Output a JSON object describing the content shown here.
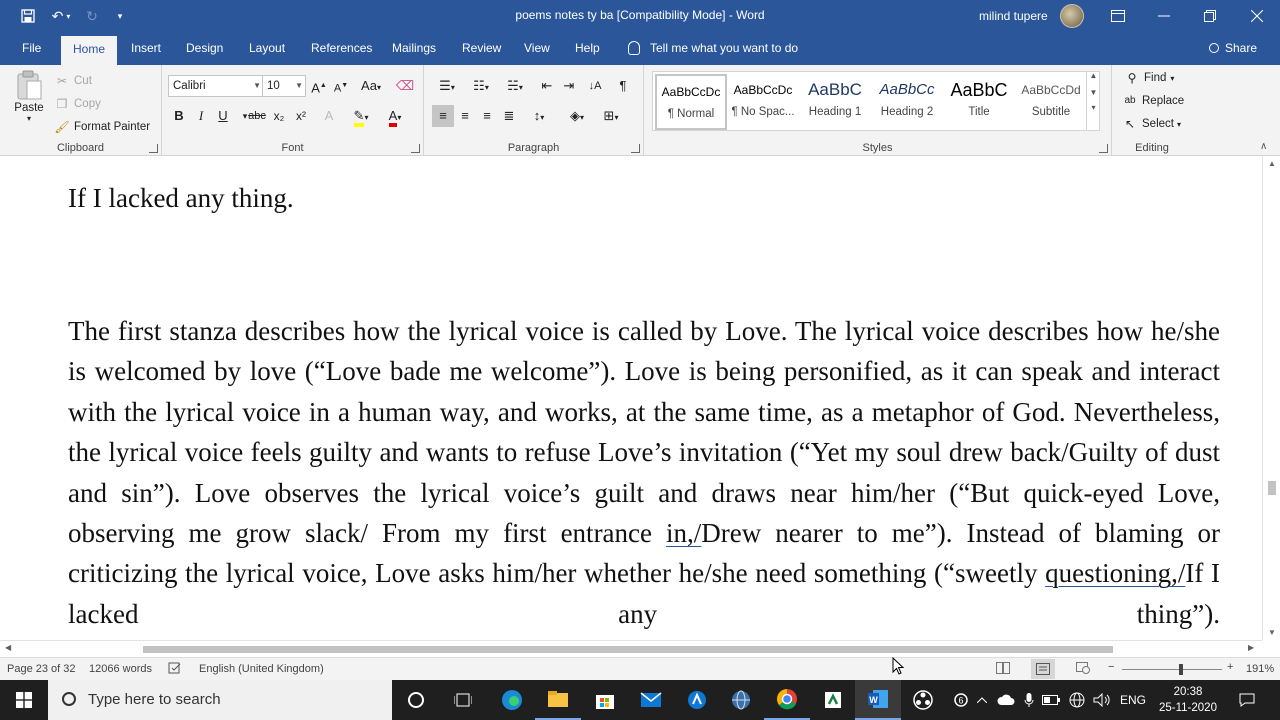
{
  "titlebar": {
    "doc_title": "poems notes ty ba [Compatibility Mode]  -  Word",
    "user_name": "milind tupere",
    "colors": {
      "brand": "#2b579a"
    }
  },
  "tabs": [
    {
      "label": "File"
    },
    {
      "label": "Home"
    },
    {
      "label": "Insert"
    },
    {
      "label": "Design"
    },
    {
      "label": "Layout"
    },
    {
      "label": "References"
    },
    {
      "label": "Mailings"
    },
    {
      "label": "Review"
    },
    {
      "label": "View"
    },
    {
      "label": "Help"
    }
  ],
  "tell_me": "Tell me what you want to do",
  "share": "Share",
  "clipboard": {
    "paste": "Paste",
    "cut": "Cut",
    "copy": "Copy",
    "format_painter": "Format Painter",
    "label": "Clipboard"
  },
  "font": {
    "name": "Calibri",
    "size": "10",
    "label": "Font",
    "bold": "B",
    "italic": "I",
    "underline": "U",
    "strike": "abc",
    "sub": "x₂",
    "sup": "x²",
    "grow": "A",
    "shrink": "A",
    "case": "Aa"
  },
  "paragraph": {
    "label": "Paragraph",
    "pilcrow": "¶"
  },
  "styles": {
    "label": "Styles",
    "items": [
      {
        "preview": "AaBbCcDc",
        "name": "¶ Normal"
      },
      {
        "preview": "AaBbCcDc",
        "name": "¶ No Spac..."
      },
      {
        "preview": "AaBbC",
        "name": "Heading 1"
      },
      {
        "preview": "AaBbCc",
        "name": "Heading 2"
      },
      {
        "preview": "AaBbC",
        "name": "Title"
      },
      {
        "preview": "AaBbCcDd",
        "name": "Subtitle"
      }
    ]
  },
  "editing": {
    "find": "Find",
    "replace": "Replace",
    "select": "Select",
    "label": "Editing"
  },
  "document": {
    "line1": "If I lacked any thing.",
    "para_a": "The first stanza describes how the lyrical voice is called by Love. The lyrical voice describes how he/she is welcomed by love (“Love bade me welcome”). Love is being personified, as it can speak and interact with the lyrical voice in a human way, and works, at the same time, as a metaphor of God. Nevertheless, the lyrical voice feels guilty and wants to refuse Love’s invitation (“Yet my soul drew back/Guilty of dust and sin”). Love observes the lyrical voice’s guilt and draws near him/her (“But quick-eyed Love, observing me grow slack/ From my first entrance ",
    "squig1": "in,/",
    "para_b": "Drew nearer to me”). Instead of blaming or criticizing the lyrical voice, Love asks him/her whether he/she need something (“sweetly ",
    "squig2": "questioning,/",
    "para_c": "If I lacked any thing”)."
  },
  "status": {
    "page": "Page 23 of 32",
    "words": "12066 words",
    "language": "English (United Kingdom)",
    "zoom": "191%",
    "zoom_level": 1.91
  },
  "taskbar": {
    "search_placeholder": "Type here to search",
    "lang": "ENG",
    "time": "20:38",
    "date": "25-11-2020"
  }
}
